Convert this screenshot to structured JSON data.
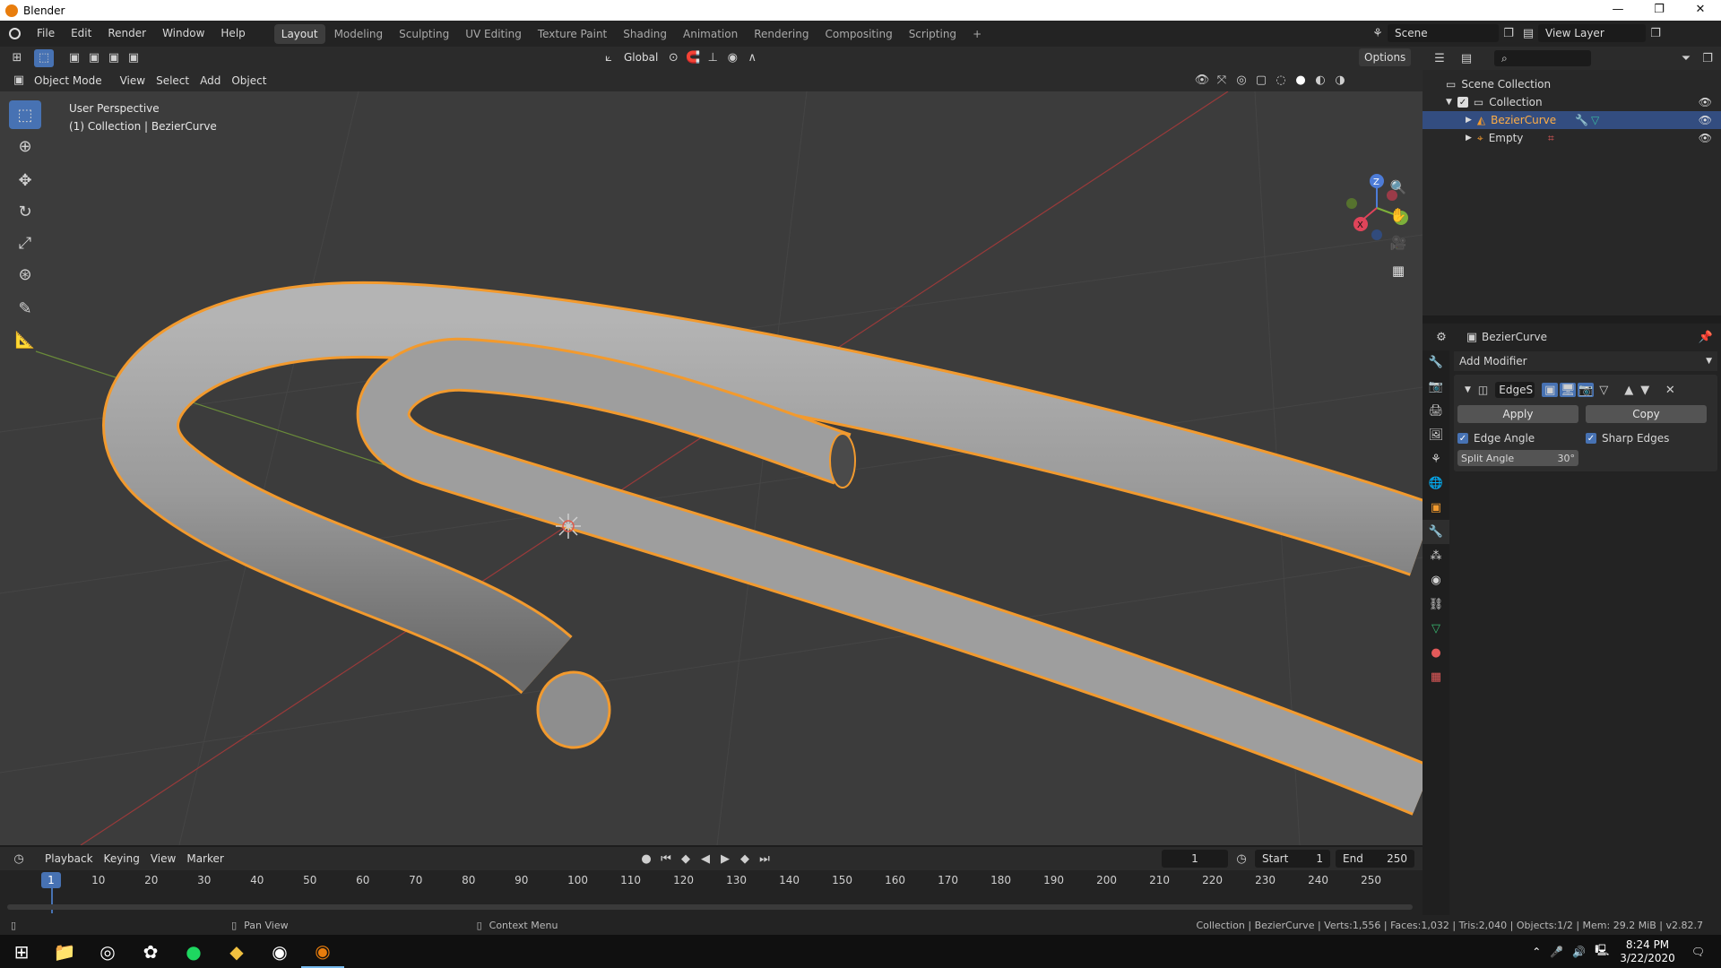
{
  "window": {
    "title": "Blender",
    "controls": [
      "—",
      "❐",
      "✕"
    ]
  },
  "menubar": {
    "menus": [
      "File",
      "Edit",
      "Render",
      "Window",
      "Help"
    ],
    "workspaces": [
      "Layout",
      "Modeling",
      "Sculpting",
      "UV Editing",
      "Texture Paint",
      "Shading",
      "Animation",
      "Rendering",
      "Compositing",
      "Scripting"
    ],
    "active_workspace": "Layout",
    "add_tab": "+",
    "scene": "Scene",
    "view_layer": "View Layer"
  },
  "viewport_header": {
    "transform_orientation": "Global",
    "options": "Options",
    "mode": "Object Mode",
    "menus": [
      "View",
      "Select",
      "Add",
      "Object"
    ]
  },
  "viewport": {
    "perspective": "User Perspective",
    "collection_info": "(1) Collection | BezierCurve",
    "gizmo": {
      "x": "X",
      "y": "Y",
      "z": "Z"
    }
  },
  "outliner": {
    "scene_collection": "Scene Collection",
    "collection": "Collection",
    "objects": [
      {
        "name": "BezierCurve",
        "selected": true
      },
      {
        "name": "Empty",
        "selected": false
      }
    ],
    "search_placeholder": ""
  },
  "properties": {
    "object_name": "BezierCurve",
    "add_modifier": "Add Modifier",
    "modifier_name": "EdgeS",
    "apply": "Apply",
    "copy": "Copy",
    "edge_angle": "Edge Angle",
    "sharp_edges": "Sharp Edges",
    "split_angle_label": "Split Angle",
    "split_angle_value": "30°"
  },
  "timeline": {
    "menus": [
      "Playback",
      "Keying",
      "View",
      "Marker"
    ],
    "current_frame": "1",
    "start_label": "Start",
    "start": "1",
    "end_label": "End",
    "end": "250",
    "ticks": [
      "10",
      "20",
      "30",
      "40",
      "50",
      "60",
      "70",
      "80",
      "90",
      "100",
      "110",
      "120",
      "130",
      "140",
      "150",
      "160",
      "170",
      "180",
      "190",
      "200",
      "210",
      "220",
      "230",
      "240",
      "250"
    ],
    "cursor_label": "1"
  },
  "statusbar": {
    "pan": "Pan View",
    "context": "Context Menu",
    "stats": "Collection | BezierCurve | Verts:1,556 | Faces:1,032 | Tris:2,040 | Objects:1/2 | Mem: 29.2 MiB | v2.82.7"
  },
  "taskbar": {
    "time": "8:24 PM",
    "date": "3/22/2020"
  },
  "colors": {
    "accent": "#4772b3",
    "selection_outline": "#f29a2e",
    "viewport_bg": "#3c3c3c"
  }
}
